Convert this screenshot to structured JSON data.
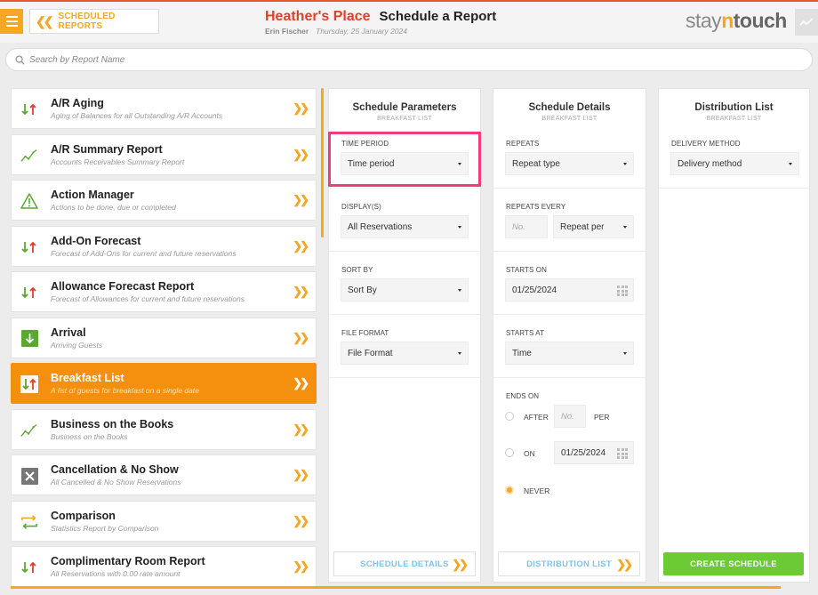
{
  "header": {
    "back_label": "SCHEDULED REPORTS",
    "hotel_name": "Heather's Place",
    "page_title": "Schedule a Report",
    "user_name": "Erin Fischer",
    "current_date": "Thursday, 25 January 2024",
    "logo_part1": "stay",
    "logo_part2": "n",
    "logo_part3": "touch"
  },
  "search": {
    "placeholder": "Search by Report Name"
  },
  "reports": [
    {
      "name": "A/R Aging",
      "desc": "Aging of Balances for all Outstanding A/R Accounts",
      "icon": "up-down-arrows-icon"
    },
    {
      "name": "A/R Summary Report",
      "desc": "Accounts Receivables Summary Report",
      "icon": "trend-chart-icon"
    },
    {
      "name": "Action Manager",
      "desc": "Actions to be done, due or completed",
      "icon": "warning-triangle-icon"
    },
    {
      "name": "Add-On Forecast",
      "desc": "Forecast of Add-Ons for current and future reservations",
      "icon": "up-down-arrows-icon"
    },
    {
      "name": "Allowance Forecast Report",
      "desc": "Forecast of Allowances for current and future reservations",
      "icon": "up-down-arrows-icon"
    },
    {
      "name": "Arrival",
      "desc": "Arriving Guests",
      "icon": "arrival-icon"
    },
    {
      "name": "Breakfast List",
      "desc": "A list of guests for breakfast on a single date",
      "icon": "up-down-arrows-icon"
    },
    {
      "name": "Business on the Books",
      "desc": "Business on the Books",
      "icon": "trend-chart-icon"
    },
    {
      "name": "Cancellation & No Show",
      "desc": "All Cancelled & No Show Reservations",
      "icon": "cancel-x-icon"
    },
    {
      "name": "Comparison",
      "desc": "Statistics Report by Comparison",
      "icon": "compare-arrows-icon"
    },
    {
      "name": "Complimentary Room Report",
      "desc": "All Reservations with 0.00 rate amount",
      "icon": "up-down-arrows-icon"
    }
  ],
  "params": {
    "title": "Schedule Parameters",
    "subtitle": "BREAKFAST LIST",
    "time_period_label": "TIME PERIOD",
    "time_period_value": "Time period",
    "displays_label": "DISPLAY(S)",
    "displays_value": "All Reservations",
    "sort_label": "SORT BY",
    "sort_value": "Sort By",
    "format_label": "FILE FORMAT",
    "format_value": "File Format",
    "footer_label": "SCHEDULE DETAILS"
  },
  "details": {
    "title": "Schedule Details",
    "subtitle": "BREAKFAST LIST",
    "repeats_label": "REPEATS",
    "repeats_value": "Repeat type",
    "every_label": "REPEATS EVERY",
    "every_placeholder": "No.",
    "every_per_value": "Repeat per",
    "starts_on_label": "STARTS ON",
    "starts_on_value": "01/25/2024",
    "starts_at_label": "STARTS AT",
    "starts_at_value": "Time",
    "ends_on_label": "ENDS ON",
    "after_label": "AFTER",
    "after_placeholder": "No.",
    "per_label": "PER",
    "on_label": "ON",
    "on_date_value": "01/25/2024",
    "never_label": "NEVER",
    "footer_label": "DISTRIBUTION LIST"
  },
  "distribution": {
    "title": "Distribution List",
    "subtitle": "BREAKFAST LIST",
    "method_label": "DELIVERY METHOD",
    "method_value": "Delivery method",
    "create_label": "CREATE SCHEDULE"
  },
  "colors": {
    "accent": "#f5a623",
    "hotel": "#e0402a",
    "highlight": "#ee3d7a",
    "create": "#6ccb35",
    "link": "#7ec4ea"
  }
}
